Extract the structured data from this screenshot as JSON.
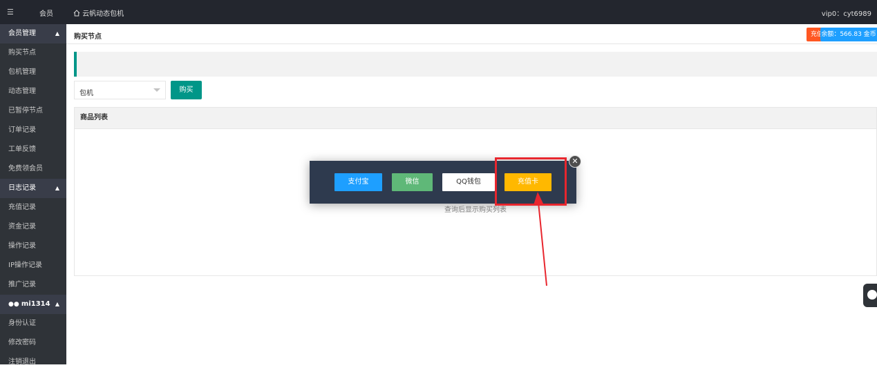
{
  "topbar": {
    "toggle_glyph": "☰",
    "member_label": "会员",
    "home_icon": "home-icon",
    "site_title": "云帆动态包机",
    "user_info": "vip0：cyt6989"
  },
  "sidebar": {
    "items": [
      {
        "label": "会员管理",
        "group": true
      },
      {
        "label": "购买节点"
      },
      {
        "label": "包机管理"
      },
      {
        "label": "动态管理"
      },
      {
        "label": "已暂停节点"
      },
      {
        "label": "订单记录"
      },
      {
        "label": "工单反馈"
      },
      {
        "label": "免费领会员"
      },
      {
        "label": "日志记录",
        "group": true
      },
      {
        "label": "充值记录"
      },
      {
        "label": "资金记录"
      },
      {
        "label": "操作记录"
      },
      {
        "label": "IP操作记录"
      },
      {
        "label": "推广记录"
      },
      {
        "label": "mi1314",
        "group": true,
        "icon": "users-icon"
      },
      {
        "label": "身份认证"
      },
      {
        "label": "修改密码"
      },
      {
        "label": "注销退出"
      }
    ]
  },
  "header": {
    "breadcrumb": "购买节点",
    "recharge_label": "充值",
    "balance_label": "余额：566.83 金币"
  },
  "form": {
    "select_value": "包机",
    "buy_label": "购买"
  },
  "list": {
    "title": "商品列表",
    "empty_text": "查询后显示购买列表"
  },
  "payment": {
    "alipay": "支付宝",
    "wechat": "微信",
    "qqwallet": "QQ钱包",
    "card": "充值卡",
    "close_glyph": "✕"
  },
  "colors": {
    "topbar": "#23262e",
    "sidebar": "#2f3338",
    "accent_green": "#009688",
    "alipay": "#1e9fff",
    "wechat": "#5fb878",
    "card": "#ffb800",
    "recharge": "#ff5722",
    "highlight": "#e8262e"
  }
}
